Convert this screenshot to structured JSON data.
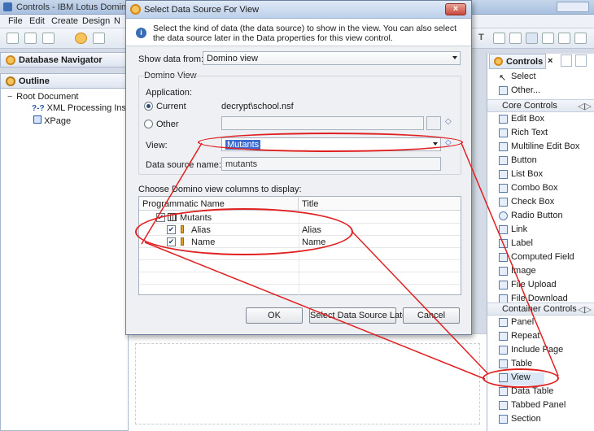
{
  "window": {
    "title": "Controls - IBM Lotus Domino D"
  },
  "menu": {
    "items": [
      "File",
      "Edit",
      "Create",
      "Design",
      "N"
    ]
  },
  "left": {
    "db_navigator": "Database Navigator",
    "outline": "Outline",
    "tree": [
      "Root Document",
      "XML Processing Instruc",
      "XPage"
    ]
  },
  "controls_panel": {
    "title": "Controls",
    "top_items": [
      "Select",
      "Other..."
    ],
    "core_header": "Core Controls",
    "core_items": [
      "Edit Box",
      "Rich Text",
      "Multiline Edit Box",
      "Button",
      "List Box",
      "Combo Box",
      "Check Box",
      "Radio Button",
      "Link",
      "Label",
      "Computed Field",
      "Image",
      "File Upload",
      "File Download"
    ],
    "container_header": "Container Controls",
    "container_items": [
      "Panel",
      "Repeat",
      "Include Page",
      "Table",
      "View",
      "Data Table",
      "Tabbed Panel",
      "Section"
    ]
  },
  "dialog": {
    "title": "Select Data Source For View",
    "info": "Select the kind of data (the data source) to show in the view. You can also select the data source later in the Data properties for this view control.",
    "show_from_label": "Show data from:",
    "show_from_value": "Domino view",
    "group_label": "Domino View",
    "application_label": "Application:",
    "current_label": "Current",
    "current_value": "decrypt\\school.nsf",
    "other_label": "Other",
    "view_label": "View:",
    "view_value": "Mutants",
    "ds_name_label": "Data source name:",
    "ds_name_value": "mutants",
    "choose_label": "Choose Domino view columns to display:",
    "columns": {
      "col1": "Programmatic Name",
      "col2": "Title"
    },
    "rows": [
      {
        "name": "Mutants",
        "title": ""
      },
      {
        "name": "Alias",
        "title": "Alias"
      },
      {
        "name": "Name",
        "title": "Name"
      }
    ],
    "ok": "OK",
    "later": "Select Data Source Later",
    "cancel": "Cancel"
  },
  "colors": {
    "annotation": "#e02020",
    "selection": "#3a6bd0"
  }
}
